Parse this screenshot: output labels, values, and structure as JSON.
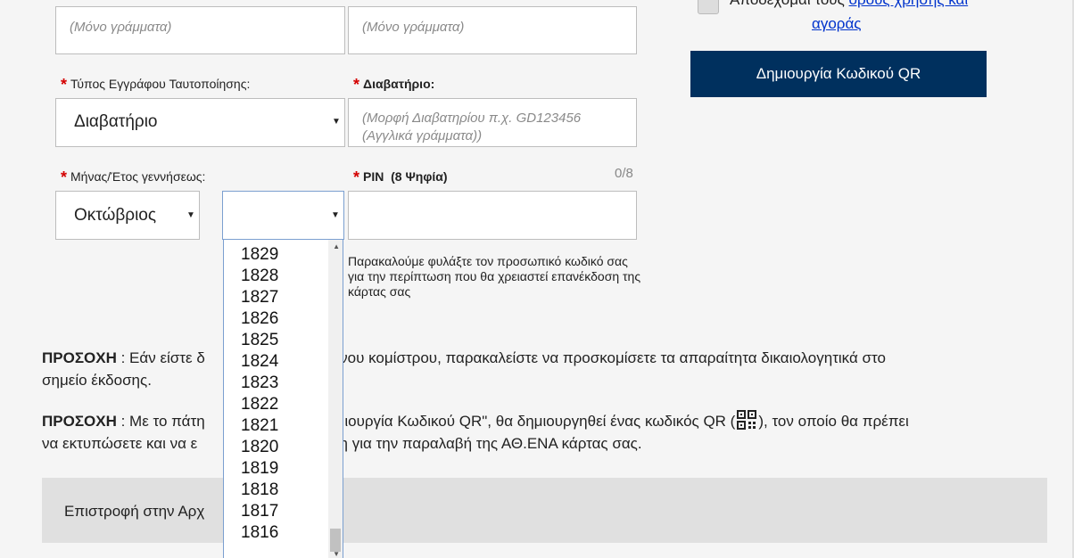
{
  "name_fields": {
    "first_placeholder": "(Μόνο γράμματα)",
    "second_placeholder": "(Μόνο γράμματα)"
  },
  "terms": {
    "text": "Αποδέχομαι τους",
    "link_line1": "όρους χρήσης και",
    "link_line2": "αγοράς"
  },
  "qr_button": {
    "label": "Δημιουργία Κωδικού QR"
  },
  "doc_type": {
    "label": "Τύπος Εγγράφου Ταυτοποίησης:",
    "value": "Διαβατήριο"
  },
  "passport": {
    "label": "Διαβατήριο:",
    "placeholder": "(Μορφή Διαβατηρίου π.χ. GD123456 (Αγγλικά γράμματα))"
  },
  "birth": {
    "label": "Μήνας/Έτος γεννήσεως:",
    "month_value": "Οκτώβριος",
    "year_value": ""
  },
  "pin": {
    "label": "PIN",
    "label_hint": "(8 Ψηφία)",
    "counter": "0/8",
    "hint": "Παρακαλούμε φυλάξτε τον προσωπικό κωδικό σας για την περίπτωση που θα χρειαστεί επανέκδοση της κάρτας σας"
  },
  "year_options": [
    "1829",
    "1828",
    "1827",
    "1826",
    "1825",
    "1824",
    "1823",
    "1822",
    "1821",
    "1820",
    "1819",
    "1818",
    "1817",
    "1816"
  ],
  "notices": {
    "n1_bold": "ΠΡΟΣΟΧΗ",
    "n1_text_a": " : Εάν είστε δ",
    "n1_text_b": "μένου κομίστρου, παρακαλείστε να προσκομίσετε τα απαραίτητα δικαιολογητικά στο",
    "n1_line2": "σημείο έκδοσης.",
    "n2_bold": "ΠΡΟΣΟΧΗ",
    "n2_text_a": " : Με το πάτη",
    "n2_text_b": "ύ \"Δημιουργία Κωδικού QR\", θα δημιουργηθεί ένας κωδικός QR (",
    "n2_text_c": "), τον οποίο θα πρέπει",
    "n2_line2_a": "να εκτυπώσετε και να ε",
    "n2_line2_b": "εκδότη για την παραλαβή της ΑΘ.ΕΝΑ κάρτας σας."
  },
  "footer": {
    "text": "Επιστροφή στην Αρχ"
  },
  "colors": {
    "accent": "#00305e",
    "required": "#d40000",
    "link": "#0033cc"
  }
}
